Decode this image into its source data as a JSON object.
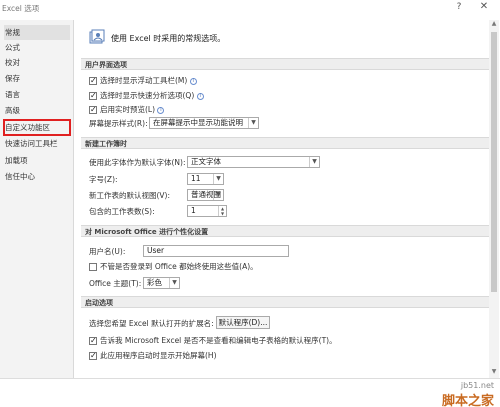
{
  "window": {
    "title": "Excel 选项",
    "help": "?",
    "close": "✕"
  },
  "sidebar": {
    "items": [
      {
        "label": "常规"
      },
      {
        "label": "公式"
      },
      {
        "label": "校对"
      },
      {
        "label": "保存"
      },
      {
        "label": "语言"
      },
      {
        "label": "高级"
      },
      {
        "label": "自定义功能区"
      },
      {
        "label": "快速访问工具栏"
      },
      {
        "label": "加载项"
      },
      {
        "label": "信任中心"
      }
    ],
    "selected": "常规",
    "highlighted": "自定义功能区"
  },
  "header": {
    "text": "使用 Excel 时采用的常规选项。",
    "icon": "general-options-icon"
  },
  "ui_options": {
    "heading": "用户界面选项",
    "show_mini_toolbar": {
      "label": "选择时显示浮动工具栏(M)",
      "checked": true
    },
    "show_quick_analysis": {
      "label": "选择时显示快速分析选项(Q)",
      "checked": true
    },
    "live_preview": {
      "label": "启用实时预览(L)",
      "checked": true
    },
    "screentip_label": "屏幕提示样式(R):",
    "screentip_value": "在屏幕提示中显示功能说明"
  },
  "new_workbook": {
    "heading": "新建工作簿时",
    "font_label": "使用此字体作为默认字体(N):",
    "font_value": "正文字体",
    "size_label": "字号(Z):",
    "size_value": "11",
    "view_label": "新工作表的默认视图(V):",
    "view_value": "普通视图",
    "sheets_label": "包含的工作表数(S):",
    "sheets_value": "1"
  },
  "personalize": {
    "heading": "对 Microsoft Office 进行个性化设置",
    "username_label": "用户名(U):",
    "username_value": "User",
    "always_use_label": "不管是否登录到 Office 都始终使用这些值(A)。",
    "always_use_checked": false,
    "theme_label": "Office 主题(T):",
    "theme_value": "彩色"
  },
  "startup": {
    "heading": "启动选项",
    "extensions_label": "选择您希望 Excel 默认打开的扩展名:",
    "default_programs_button": "默认程序(D)...",
    "tell_me_label": "告诉我 Microsoft Excel 是否不是查看和编辑电子表格的默认程序(T)。",
    "tell_me_checked": true,
    "show_start_label": "此应用程序启动时显示开始屏幕(H)",
    "show_start_checked": true
  },
  "watermark": {
    "url": "jb51.net",
    "brand": "脚本之家"
  }
}
